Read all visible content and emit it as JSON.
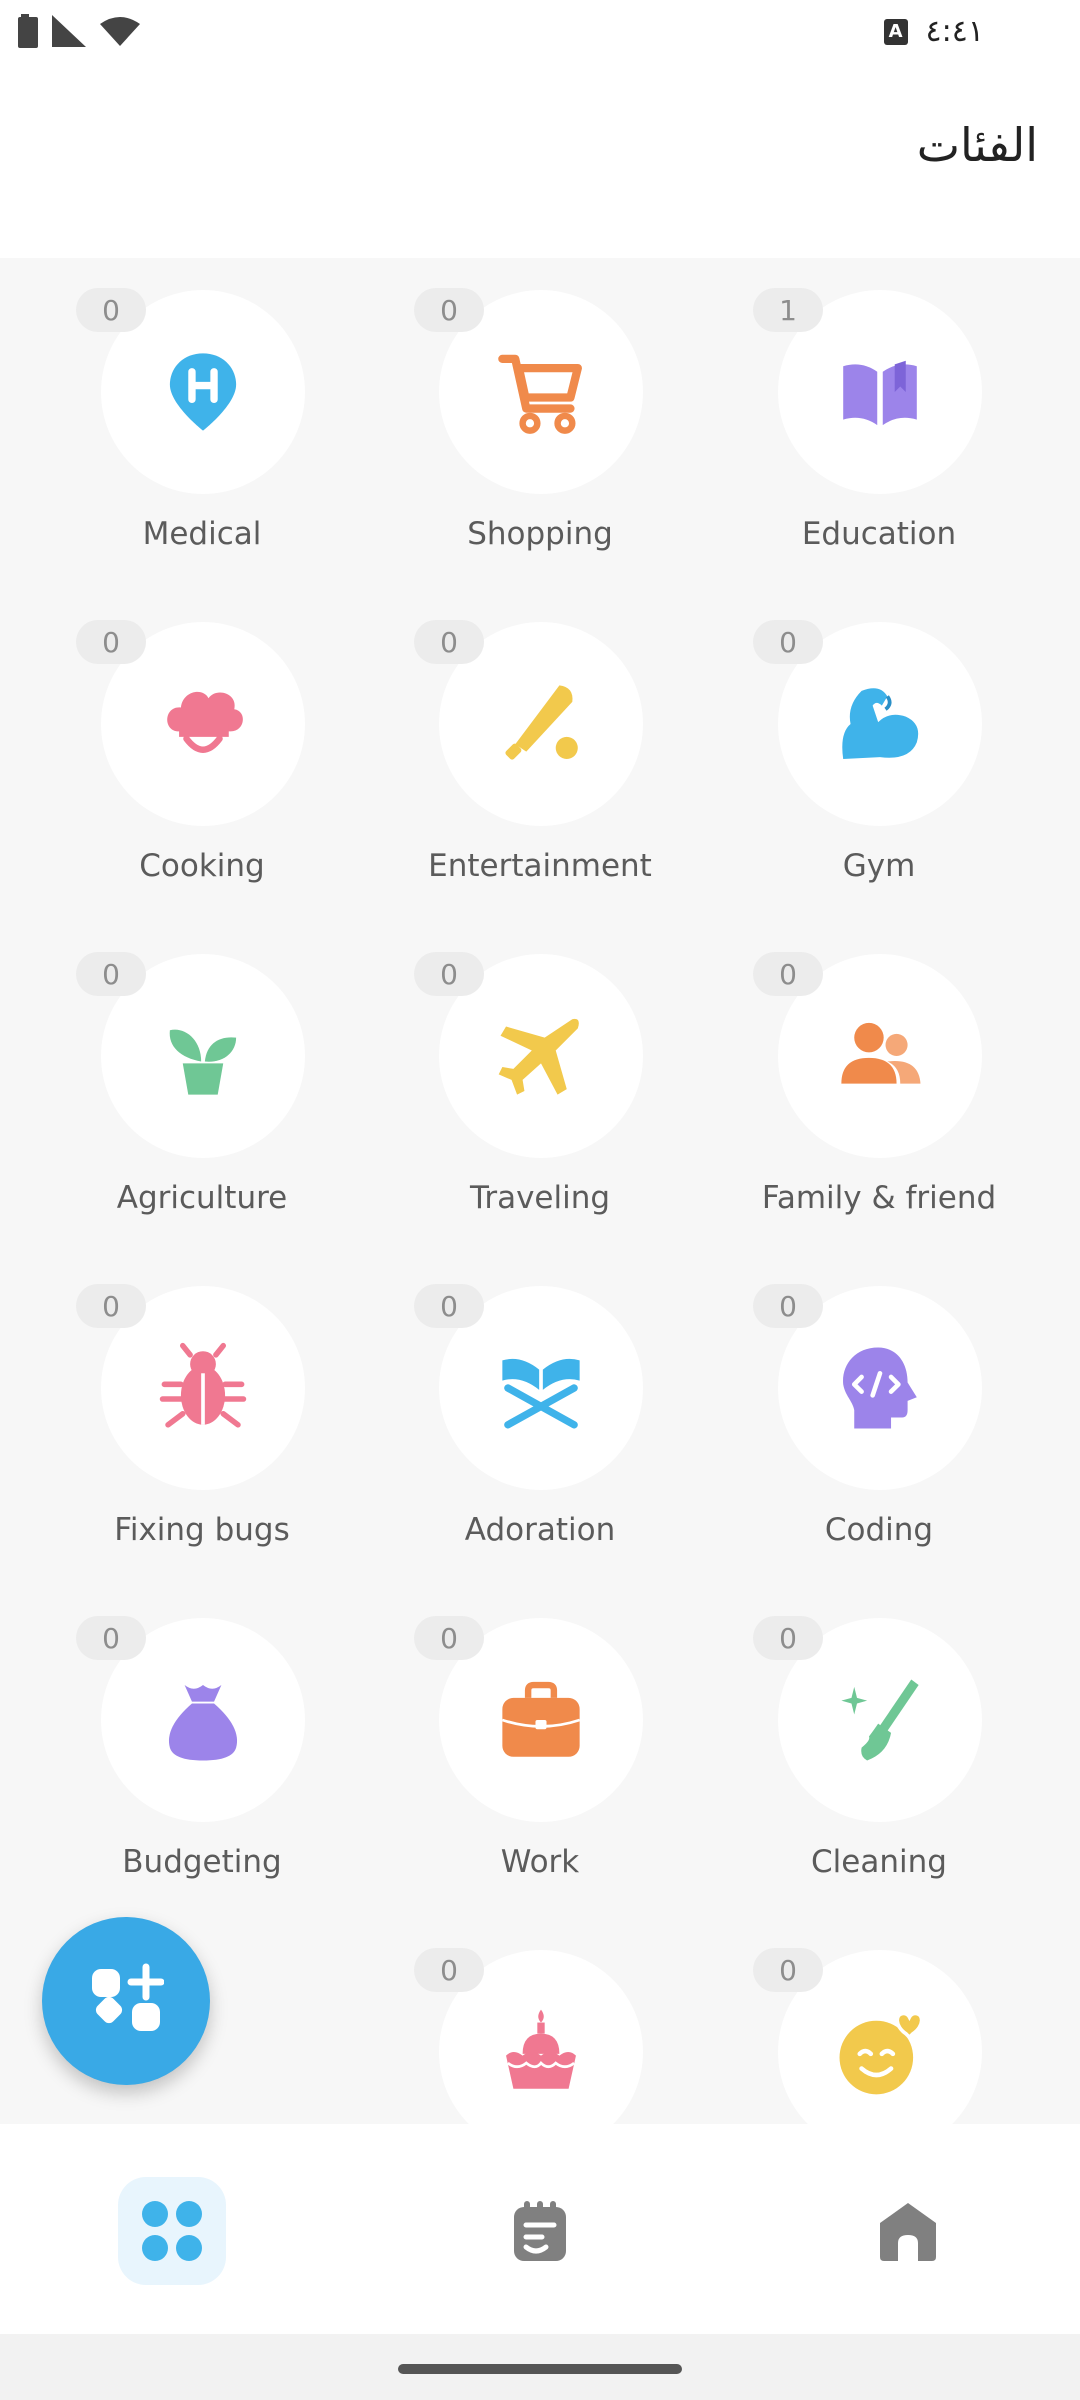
{
  "status_bar": {
    "time": "٤:٤١",
    "keyboard_badge": "A"
  },
  "header": {
    "title": "الفئات"
  },
  "categories": [
    {
      "label": "Medical",
      "count": "0",
      "icon": "medical-pin-icon",
      "color": "#3fb3ea"
    },
    {
      "label": "Shopping",
      "count": "0",
      "icon": "shopping-cart-icon",
      "color": "#f08a4b"
    },
    {
      "label": "Education",
      "count": "1",
      "icon": "open-book-icon",
      "color": "#9c84ea"
    },
    {
      "label": "Cooking",
      "count": "0",
      "icon": "chef-hat-icon",
      "color": "#f07891"
    },
    {
      "label": "Entertainment",
      "count": "0",
      "icon": "baseball-bat-icon",
      "color": "#f2c94c"
    },
    {
      "label": "Gym",
      "count": "0",
      "icon": "flexed-arm-icon",
      "color": "#3fb3ea"
    },
    {
      "label": "Agriculture",
      "count": "0",
      "icon": "potted-plant-icon",
      "color": "#6fc795"
    },
    {
      "label": "Traveling",
      "count": "0",
      "icon": "airplane-icon",
      "color": "#f2c94c"
    },
    {
      "label": "Family & friend",
      "count": "0",
      "icon": "people-icon",
      "color": "#f08a4b"
    },
    {
      "label": "Fixing bugs",
      "count": "0",
      "icon": "bug-icon",
      "color": "#f07891"
    },
    {
      "label": "Adoration",
      "count": "0",
      "icon": "book-stand-icon",
      "color": "#3fb3ea"
    },
    {
      "label": "Coding",
      "count": "0",
      "icon": "code-head-icon",
      "color": "#9c84ea"
    },
    {
      "label": "Budgeting",
      "count": "0",
      "icon": "money-bag-icon",
      "color": "#9c84ea"
    },
    {
      "label": "Work",
      "count": "0",
      "icon": "briefcase-icon",
      "color": "#f08a4b"
    },
    {
      "label": "Cleaning",
      "count": "0",
      "icon": "broom-icon",
      "color": "#6fc795"
    },
    {
      "label": "",
      "count": "0",
      "icon": "cupcake-icon",
      "color": "#f07891"
    },
    {
      "label": "",
      "count": "0",
      "icon": "smiley-heart-icon",
      "color": "#f2c94c"
    }
  ],
  "fab": {
    "icon": "add-category-icon",
    "color": "#39a9e6"
  },
  "bottom_nav": [
    {
      "icon": "categories-grid-icon",
      "active": true
    },
    {
      "icon": "notes-icon",
      "active": false
    },
    {
      "icon": "home-icon",
      "active": false
    }
  ]
}
